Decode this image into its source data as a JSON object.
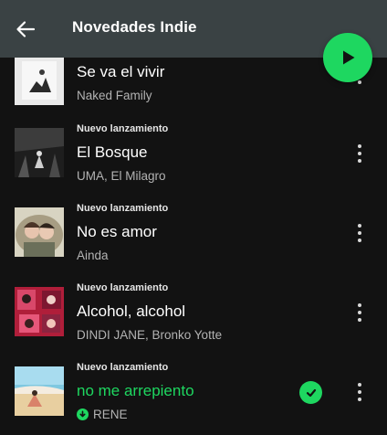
{
  "header": {
    "title": "Novedades Indie"
  },
  "colors": {
    "accent": "#1ed760",
    "header_bg": "#3a4244",
    "background": "#121212",
    "secondary_text": "#b3b3b3"
  },
  "tracks": [
    {
      "tag": "",
      "title": "Se va el vivir",
      "artist": "Naked Family",
      "icon": "album-art"
    },
    {
      "tag": "Nuevo lanzamiento",
      "title": "El Bosque",
      "artist": "UMA, El Milagro",
      "icon": "album-art"
    },
    {
      "tag": "Nuevo lanzamiento",
      "title": "No es amor",
      "artist": "Ainda",
      "icon": "album-art"
    },
    {
      "tag": "Nuevo lanzamiento",
      "title": "Alcohol, alcohol",
      "artist": "DINDI JANE, Bronko Yotte",
      "icon": "album-art"
    },
    {
      "tag": "Nuevo lanzamiento",
      "title": "no me arrepiento",
      "artist": "RENE",
      "icon": "album-art",
      "playing": true,
      "downloaded": true,
      "added": true
    }
  ]
}
